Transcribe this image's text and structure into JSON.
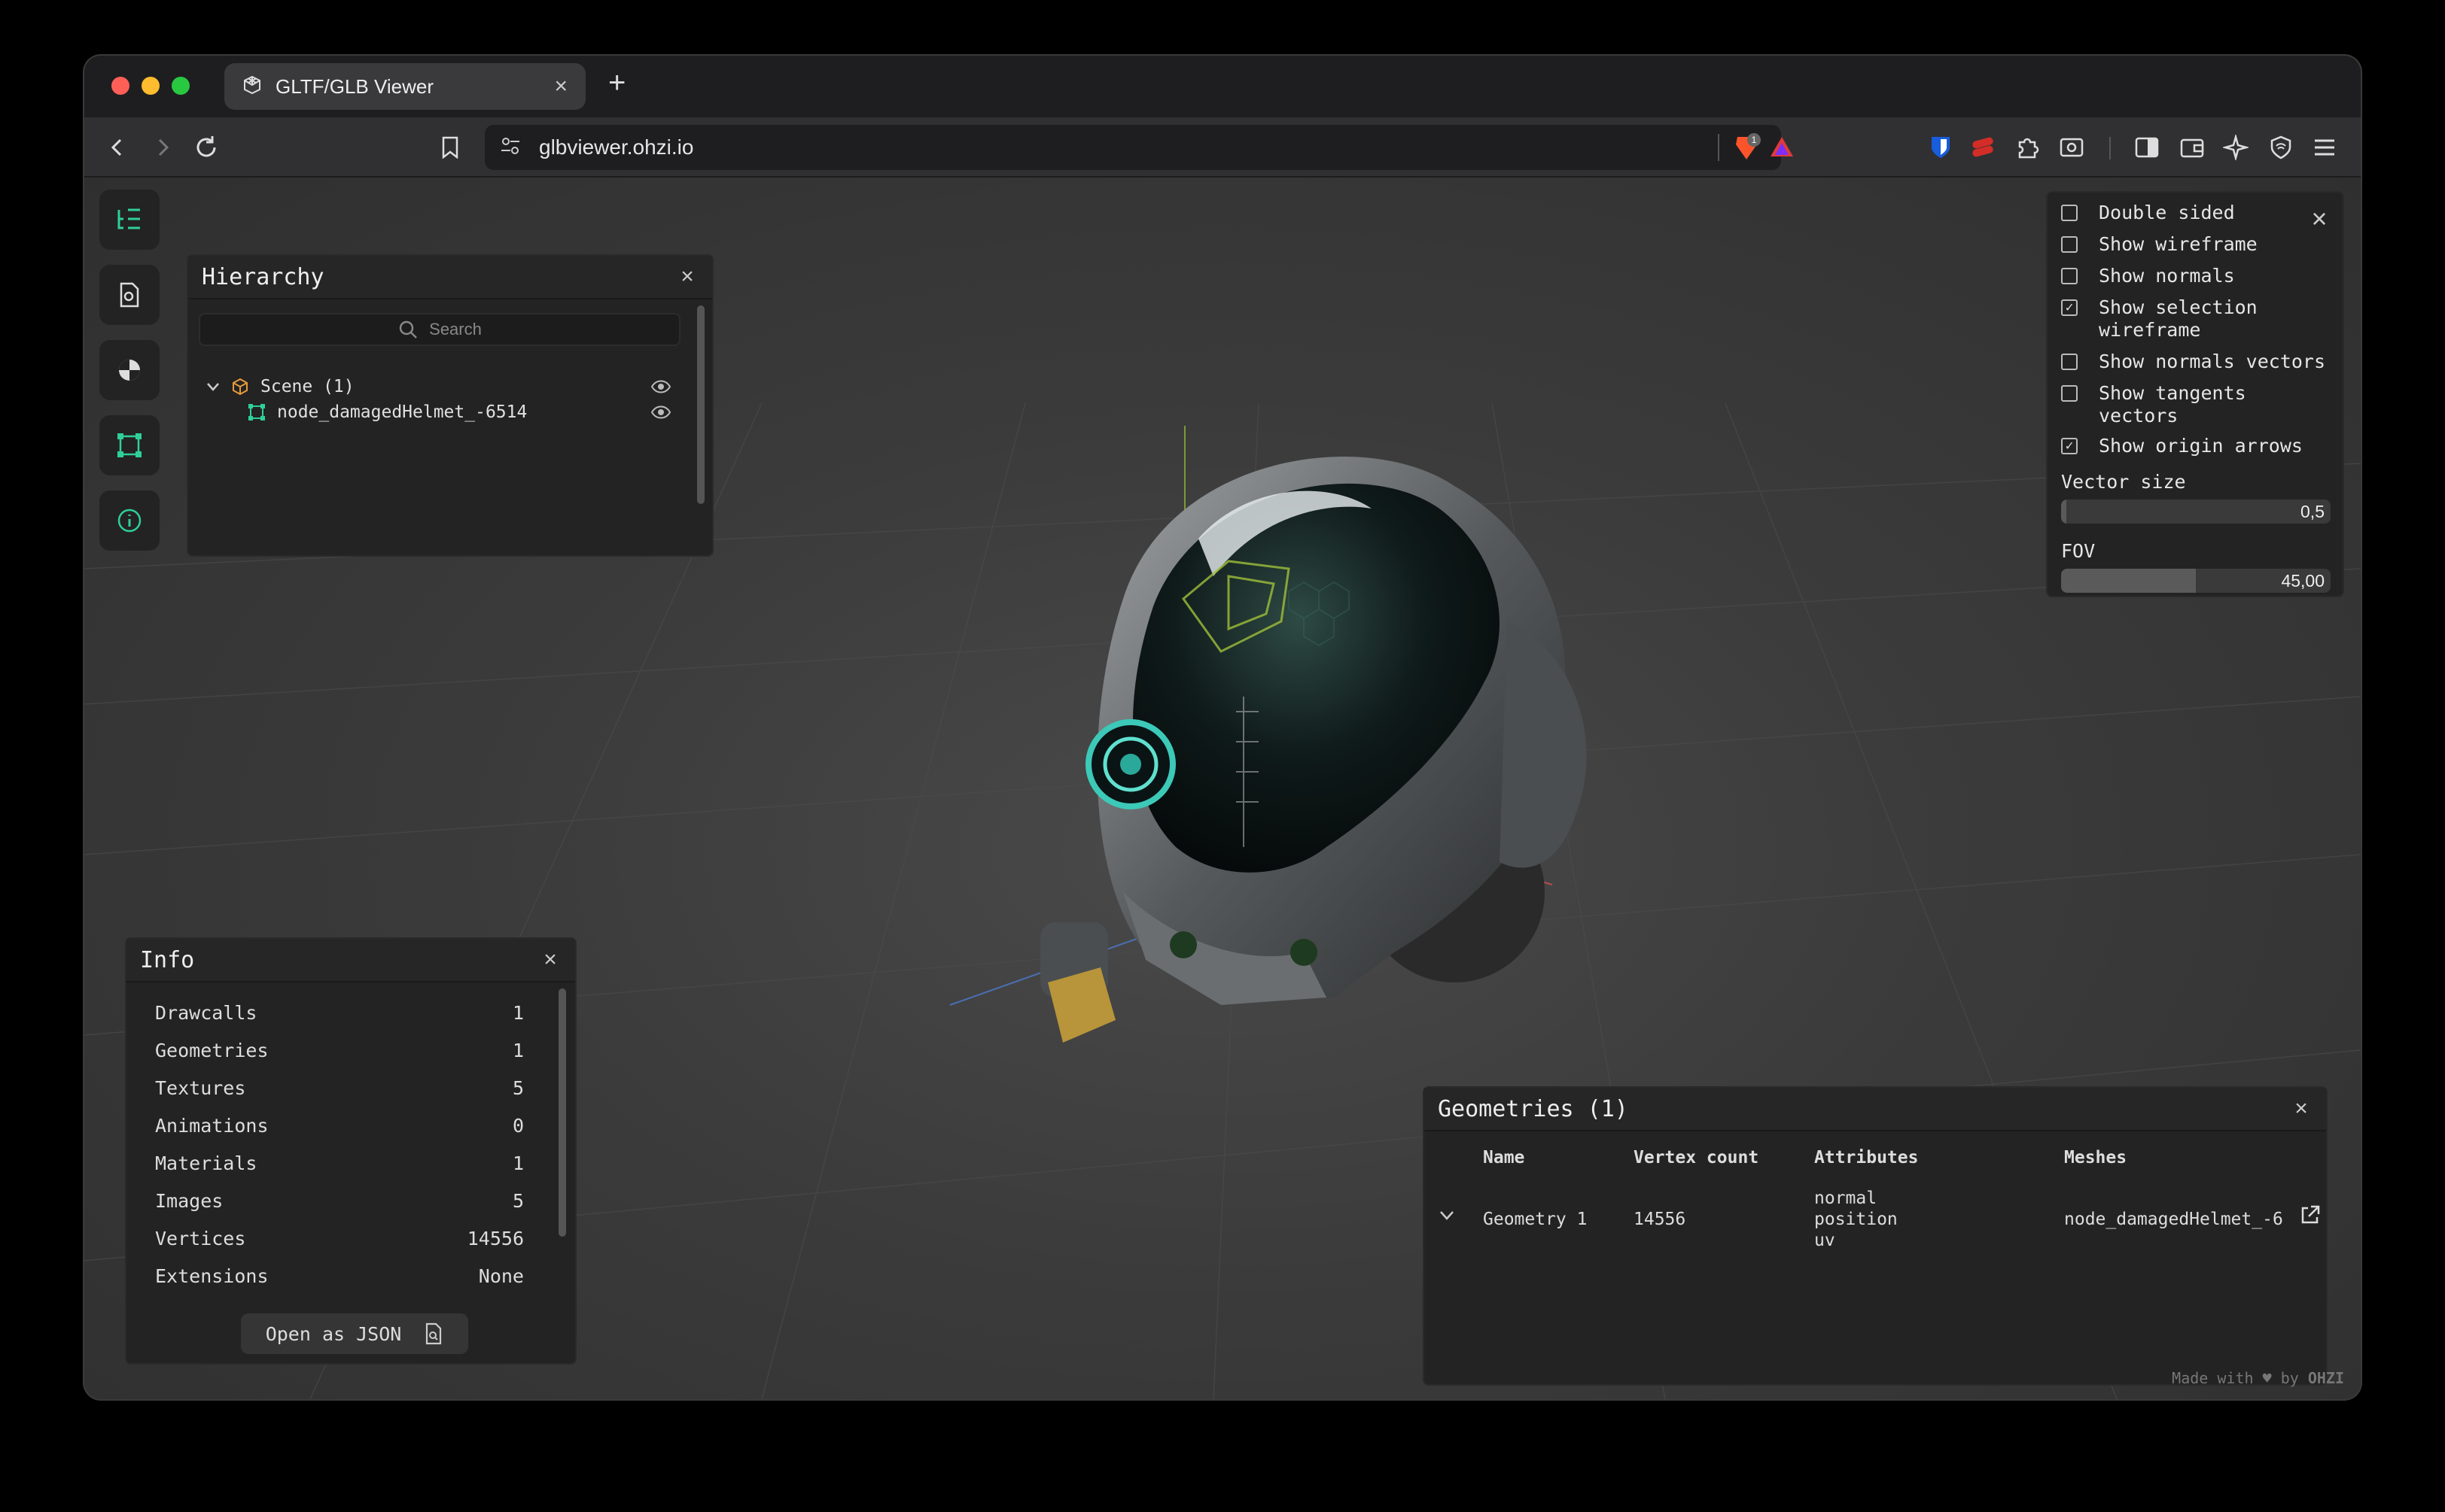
{
  "browser": {
    "tab_title": "GLTF/GLB Viewer",
    "url": "glbviewer.ohzi.io",
    "shield_badge": "1"
  },
  "hierarchy": {
    "title": "Hierarchy",
    "search_placeholder": "Search",
    "nodes": [
      {
        "label": "Scene (1)",
        "icon": "cube-icon"
      },
      {
        "label": "node_damagedHelmet_-6514",
        "icon": "mesh-icon"
      }
    ]
  },
  "info": {
    "title": "Info",
    "rows": [
      {
        "label": "Drawcalls",
        "value": "1"
      },
      {
        "label": "Geometries",
        "value": "1"
      },
      {
        "label": "Textures",
        "value": "5"
      },
      {
        "label": "Animations",
        "value": "0"
      },
      {
        "label": "Materials",
        "value": "1"
      },
      {
        "label": "Images",
        "value": "5"
      },
      {
        "label": "Vertices",
        "value": "14556"
      },
      {
        "label": "Extensions",
        "value": "None"
      }
    ],
    "open_json_label": "Open as JSON"
  },
  "settings": {
    "options": [
      {
        "label": "Double sided",
        "checked": false
      },
      {
        "label": "Show wireframe",
        "checked": false
      },
      {
        "label": "Show normals",
        "checked": false
      },
      {
        "label": "Show selection wireframe",
        "checked": true
      },
      {
        "label": "Show normals vectors",
        "checked": false
      },
      {
        "label": "Show tangents vectors",
        "checked": false
      },
      {
        "label": "Show origin arrows",
        "checked": true
      }
    ],
    "vector_size": {
      "label": "Vector size",
      "value": "0,5",
      "fill_fraction": 0.02
    },
    "fov": {
      "label": "FOV",
      "value": "45,00",
      "fill_fraction": 0.5
    }
  },
  "geometries": {
    "title": "Geometries (1)",
    "columns": [
      "Name",
      "Vertex count",
      "Attributes",
      "Meshes"
    ],
    "rows": [
      {
        "name": "Geometry 1",
        "vertex_count": "14556",
        "attributes": [
          "normal",
          "position",
          "uv"
        ],
        "meshes": "node_damagedHelmet_-6"
      }
    ]
  },
  "footer": {
    "made_with": "Made with",
    "by": "by",
    "brand": "OHZI"
  }
}
